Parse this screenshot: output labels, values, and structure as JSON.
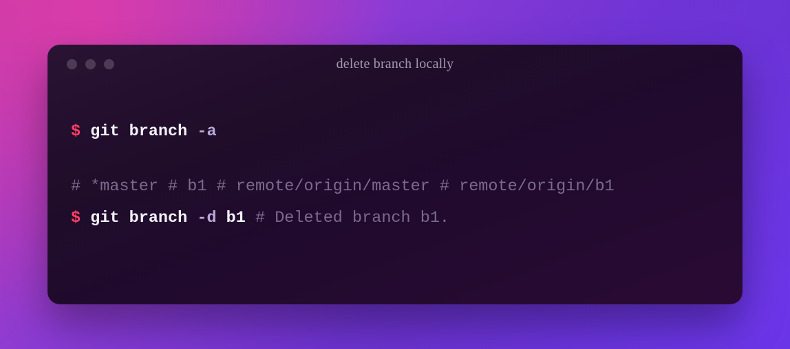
{
  "window": {
    "title": "delete branch locally"
  },
  "lines": {
    "l0": {
      "prompt": "$",
      "cmd": "git branch ",
      "flag": "-a"
    },
    "l1": {
      "comment": "# *master # b1 # remote/origin/master # remote/origin/b1"
    },
    "l2": {
      "prompt": "$",
      "cmd": "git branch ",
      "flag": "-d",
      "arg": " b1",
      "comment": " # Deleted branch b1."
    }
  }
}
